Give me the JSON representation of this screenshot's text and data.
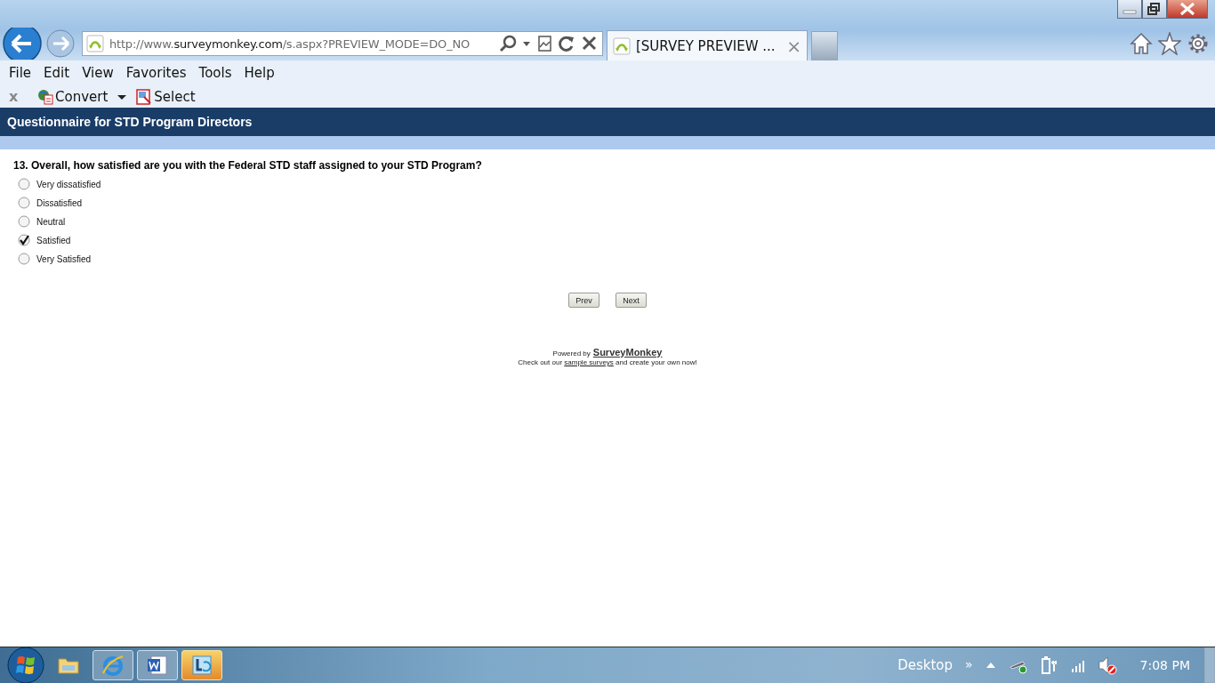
{
  "browser": {
    "address": {
      "prefix": "http://www.",
      "domain": "surveymonkey.com",
      "path": "/s.aspx?PREVIEW_MODE=DO_NO"
    },
    "tab": {
      "title": "[SURVEY PREVIEW ...",
      "close": "×"
    },
    "menu": [
      "File",
      "Edit",
      "View",
      "Favorites",
      "Tools",
      "Help"
    ],
    "command_bar": {
      "close": "x",
      "buttons": [
        {
          "kind": "convert",
          "label": "Convert"
        },
        {
          "kind": "select",
          "label": "Select"
        }
      ]
    }
  },
  "survey": {
    "title": "Questionnaire for STD Program Directors",
    "question": "13. Overall, how satisfied are you with the Federal STD staff assigned to your STD Program?",
    "options": [
      {
        "label": "Very dissatisfied",
        "selected": false
      },
      {
        "label": "Dissatisfied",
        "selected": false
      },
      {
        "label": "Neutral",
        "selected": false
      },
      {
        "label": "Satisfied",
        "selected": true
      },
      {
        "label": "Very Satisfied",
        "selected": false
      }
    ],
    "buttons": [
      "Prev",
      "Next"
    ],
    "footer": {
      "powered_by": "Powered by",
      "brand": "SurveyMonkey",
      "line_start": "Check out our",
      "link": "sample surveys",
      "line_end": "and create your own now!"
    }
  },
  "taskbar": {
    "apps": [
      {
        "kind": "folder"
      },
      {
        "kind": "ie"
      },
      {
        "kind": "word"
      },
      {
        "kind": "lync"
      }
    ],
    "desktop": "Desktop",
    "chevron": "»",
    "time": "7:08 PM"
  }
}
